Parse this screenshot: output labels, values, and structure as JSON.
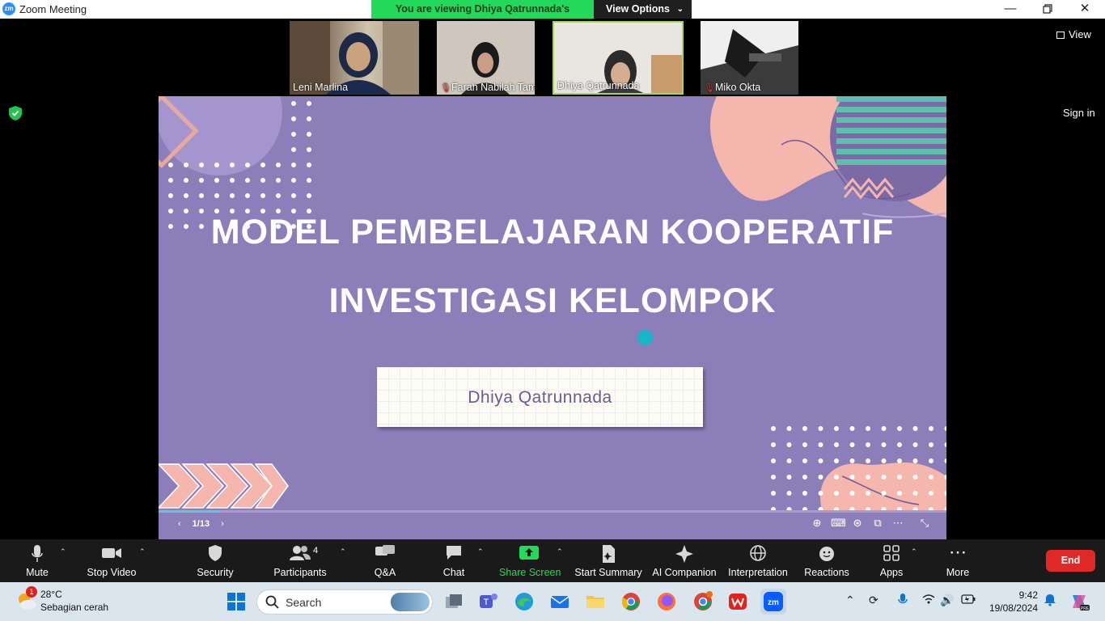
{
  "window": {
    "title": "Zoom Meeting",
    "app_logo": "zm"
  },
  "banner": {
    "message": "You are viewing Dhiya Qatrunnada's screen",
    "options_label": "View Options"
  },
  "participants_strip": [
    {
      "name": "Leni Marlina",
      "muted": false,
      "active": false
    },
    {
      "name": "Farah Nabilah Tampu...",
      "muted": true,
      "active": false
    },
    {
      "name": "Dhiya Qatrunnada",
      "muted": false,
      "active": true
    },
    {
      "name": "Miko Okta",
      "muted": true,
      "active": false
    }
  ],
  "top_right": {
    "view_label": "View",
    "signin_label": "Sign in"
  },
  "slide": {
    "title_line1": "MODEL PEMBELAJARAN KOOPERATIF",
    "title_line2": "INVESTIGASI KELOMPOK",
    "presenter": "Dhiya Qatrunnada",
    "page_indicator": "1/13",
    "progress_fraction": 0.077
  },
  "toolbar": {
    "mute": "Mute",
    "stop_video": "Stop Video",
    "security": "Security",
    "participants": "Participants",
    "participants_count": "4",
    "qa": "Q&A",
    "chat": "Chat",
    "share_screen": "Share Screen",
    "start_summary": "Start Summary",
    "ai_companion": "AI Companion",
    "interpretation": "Interpretation",
    "reactions": "Reactions",
    "apps": "Apps",
    "more": "More",
    "end": "End"
  },
  "taskbar": {
    "weather_temp": "28°C",
    "weather_desc": "Sebagian cerah",
    "weather_badge": "1",
    "search_placeholder": "Search",
    "time": "9:42",
    "date": "19/08/2024"
  },
  "colors": {
    "share_green": "#23d959",
    "end_red": "#e02828",
    "slide_bg": "#8c7eb8",
    "toolbar_bg": "#1a1a1a"
  }
}
